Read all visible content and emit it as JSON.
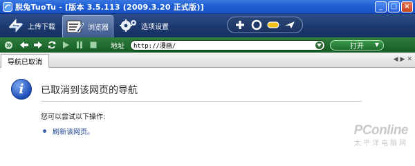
{
  "window": {
    "title": "脱兔TuoTu - [版本 3.5.113 (2009.3.20 正式版)]",
    "controls": [
      "_",
      "□",
      "×"
    ]
  },
  "toolbar": {
    "upload_download": "上传下载",
    "browser": "浏览器",
    "options": "选项设置",
    "quick_icons": [
      "add-icon",
      "refresh-circle-icon",
      "minus-icon",
      "pin-icon"
    ]
  },
  "addressbar": {
    "label": "地址",
    "url": "http://漫画/",
    "go_label": "打开"
  },
  "tabs": [
    {
      "label": "导航已取消"
    }
  ],
  "page": {
    "title": "已取消到该网页的导航",
    "suggestion": "您可以尝试以下操作:",
    "action_link": "刷新该网页。"
  },
  "watermark": {
    "brand": "PConline",
    "sub": "太平洋电脑网"
  },
  "colors": {
    "titlebar": "#1f5fd6",
    "toolbar": "#1d3a70",
    "addressbar": "#1e6a2e",
    "info_icon": "#1f4fb8"
  }
}
